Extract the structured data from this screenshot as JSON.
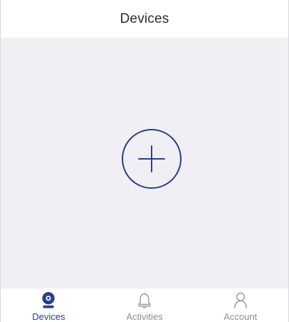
{
  "header": {
    "title": "Devices"
  },
  "main": {
    "add_device_icon": "plus-circle-icon"
  },
  "tabbar": {
    "items": [
      {
        "label": "Devices",
        "icon": "camera-icon",
        "active": true
      },
      {
        "label": "Activities",
        "icon": "bell-icon",
        "active": false
      },
      {
        "label": "Account",
        "icon": "user-icon",
        "active": false
      }
    ]
  },
  "colors": {
    "accent": "#2c3e8c",
    "inactive": "#8e8e93",
    "content_background": "#efeff4",
    "header_background": "#ffffff"
  }
}
